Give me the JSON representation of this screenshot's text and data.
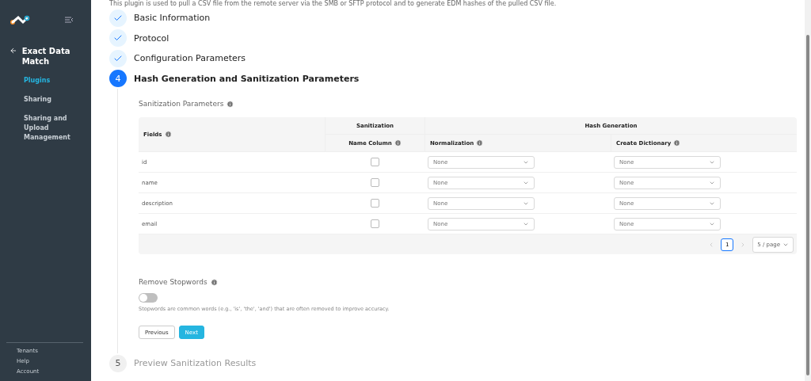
{
  "sidebar": {
    "title": "Exact Data Match",
    "items": [
      {
        "label": "Plugins",
        "selected": true
      },
      {
        "label": "Sharing",
        "selected": false
      },
      {
        "label": "Sharing and Upload Management",
        "selected": false
      }
    ],
    "footer_items": [
      "Tenants",
      "Help",
      "Account"
    ]
  },
  "intro": "This plugin is used to pull a CSV file from the remote server via the SMB or SFTP protocol and to generate EDM hashes of the pulled CSV file.",
  "steps": [
    {
      "kind": "done",
      "label": "Basic Information"
    },
    {
      "kind": "done",
      "label": "Protocol"
    },
    {
      "kind": "done",
      "label": "Configuration Parameters"
    },
    {
      "kind": "active",
      "number": "4",
      "label": "Hash Generation and Sanitization Parameters"
    },
    {
      "kind": "pending",
      "number": "5",
      "label": "Preview Sanitization Results"
    }
  ],
  "section_title": "Sanitization Parameters",
  "table": {
    "fields_header": "Fields",
    "group_sanitization": "Sanitization",
    "group_hash": "Hash Generation",
    "columns": [
      "Name Column",
      "Normalization",
      "Create Dictionary"
    ],
    "rows": [
      {
        "field": "id",
        "name_column": false,
        "normalization": "None",
        "create_dictionary": "None"
      },
      {
        "field": "name",
        "name_column": false,
        "normalization": "None",
        "create_dictionary": "None"
      },
      {
        "field": "description",
        "name_column": false,
        "normalization": "None",
        "create_dictionary": "None"
      },
      {
        "field": "email",
        "name_column": false,
        "normalization": "None",
        "create_dictionary": "None"
      }
    ]
  },
  "pagination": {
    "pages": [
      {
        "label": "1",
        "selected": true
      }
    ],
    "page_size": "5 / page"
  },
  "stopwords": {
    "label": "Remove Stopwords",
    "on": false,
    "help": "Stopwords are common words (e.g., 'is', 'the', 'and') that are often removed to improve accuracy."
  },
  "buttons": {
    "previous": "Previous",
    "next": "Next"
  }
}
